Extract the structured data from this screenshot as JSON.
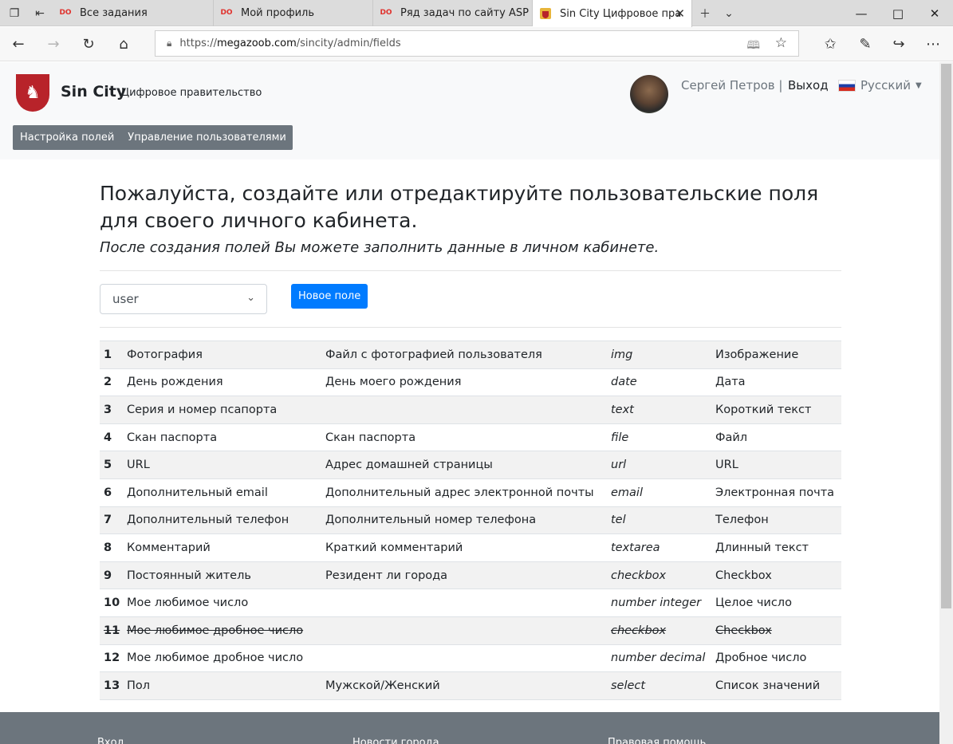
{
  "browser": {
    "tabs": [
      {
        "title": "Все задания",
        "favicon": "do-icon"
      },
      {
        "title": "Мой профиль",
        "favicon": "do-icon"
      },
      {
        "title": "Ряд задач по сайту ASP - u",
        "favicon": "do-icon"
      },
      {
        "title": "Sin City Цифровое пра",
        "favicon": "crest-icon",
        "active": true
      }
    ],
    "favicon_text": "DO",
    "url_prefix": "https://",
    "url_host": "megazoob.com",
    "url_path": "/sincity/admin/fields"
  },
  "header": {
    "brand": "Sin City",
    "brand_sub": "Цифровое правительство",
    "user_name": "Сергей Петров |",
    "logout": "Выход",
    "language": "Русский"
  },
  "menu": {
    "items": [
      "Настройка полей",
      "Управление пользователями"
    ],
    "color": "#6c757d"
  },
  "main": {
    "heading": "Пожалуйста, создайте или отредактируйте пользовательские поля для своего личного кабинета.",
    "lead": "После создания полей Вы можете заполнить данные в личном кабинете.",
    "select_value": "user",
    "new_field_button": "Новое поле",
    "accent": "#007bff"
  },
  "fields": [
    {
      "num": "1",
      "name": "Фотография",
      "desc": "Файл с фотографией пользователя",
      "type": "img",
      "label": "Изображение",
      "struck": false
    },
    {
      "num": "2",
      "name": "День рождения",
      "desc": "День моего рождения",
      "type": "date",
      "label": "Дата",
      "struck": false
    },
    {
      "num": "3",
      "name": "Серия и номер псапорта",
      "desc": "",
      "type": "text",
      "label": "Короткий текст",
      "struck": false
    },
    {
      "num": "4",
      "name": "Скан паспорта",
      "desc": "Скан паспорта",
      "type": "file",
      "label": "Файл",
      "struck": false
    },
    {
      "num": "5",
      "name": "URL",
      "desc": "Адрес домашней страницы",
      "type": "url",
      "label": "URL",
      "struck": false
    },
    {
      "num": "6",
      "name": "Дополнительный email",
      "desc": "Дополнительный адрес электронной почты",
      "type": "email",
      "label": "Электронная почта",
      "struck": false
    },
    {
      "num": "7",
      "name": "Дополнительный телефон",
      "desc": "Дополнительный номер телефона",
      "type": "tel",
      "label": "Телефон",
      "struck": false
    },
    {
      "num": "8",
      "name": "Комментарий",
      "desc": "Краткий комментарий",
      "type": "textarea",
      "label": "Длинный текст",
      "struck": false
    },
    {
      "num": "9",
      "name": "Постоянный житель",
      "desc": "Резидент ли города",
      "type": "checkbox",
      "label": "Checkbox",
      "struck": false
    },
    {
      "num": "10",
      "name": "Мое любимое число",
      "desc": "",
      "type": "number integer",
      "label": "Целое число",
      "struck": false
    },
    {
      "num": "11",
      "name": "Мое любимое дробное число",
      "desc": "",
      "type": "checkbox",
      "label": "Checkbox",
      "struck": true
    },
    {
      "num": "12",
      "name": "Мое любимое дробное число",
      "desc": "",
      "type": "number decimal",
      "label": "Дробное число",
      "struck": false
    },
    {
      "num": "13",
      "name": "Пол",
      "desc": "Мужской/Женский",
      "type": "select",
      "label": "Список значений",
      "struck": false
    }
  ],
  "footer": {
    "columns": [
      "Вход",
      "Новости города",
      "Правовая помощь"
    ]
  }
}
